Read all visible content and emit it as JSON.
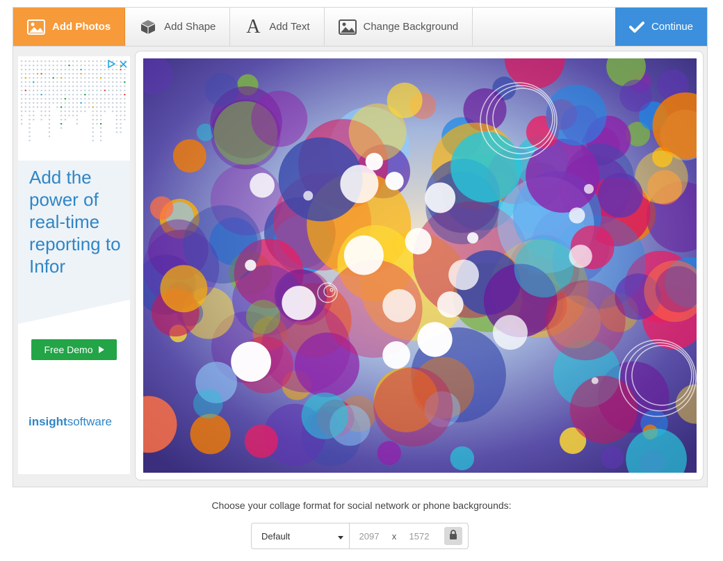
{
  "toolbar": {
    "add_photos": "Add Photos",
    "add_shape": "Add Shape",
    "add_text": "Add Text",
    "change_background": "Change Background",
    "continue": "Continue",
    "colors": {
      "active": "#f79a3a",
      "continue": "#3b8fdc"
    }
  },
  "ad": {
    "headline": "Add the power of real-time reporting to Infor",
    "cta": "Free Demo",
    "brand_bold": "insight",
    "brand_rest": "software",
    "icons": [
      "adchoices-icon",
      "close-icon"
    ]
  },
  "canvas": {
    "content": "colorful bokeh bubbles photo"
  },
  "format": {
    "label": "Choose your collage format for social network or phone backgrounds:",
    "selected": "Default",
    "width": "2097",
    "times": "x",
    "height": "1572"
  }
}
